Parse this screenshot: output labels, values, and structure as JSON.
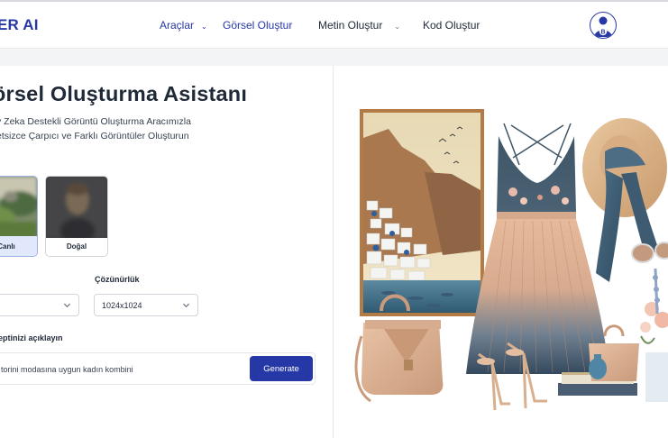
{
  "header": {
    "brand": "ER AI",
    "nav": [
      {
        "label": "Araçlar",
        "has_dropdown": true,
        "active": true
      },
      {
        "label": "Görsel Oluştur",
        "has_dropdown": false,
        "active": true
      },
      {
        "label": "Metin Oluştur",
        "has_dropdown": true,
        "active": false
      },
      {
        "label": "Kod Oluştur",
        "has_dropdown": false,
        "active": false
      }
    ],
    "avatar_initial": "B",
    "chevron": "⌄"
  },
  "main": {
    "title": "örsel Oluşturma Asistanı",
    "subtitle_line1": "y Zeka Destekli Görüntü Oluşturma Aracımızla",
    "subtitle_line2": "etsizce Çarpıcı ve Farklı Görüntüler Oluşturun",
    "styles": [
      {
        "label": "Canlı",
        "selected": true
      },
      {
        "label": "Doğal",
        "selected": false
      }
    ],
    "resolution_label": "Çözünürlük",
    "resolution_value": "1024x1024",
    "prompt_label": "eptinizi açıklayın",
    "prompt_value": "torini modasına uygun kadın kombini",
    "generate_label": "Generate"
  },
  "colors": {
    "accent": "#2638a6",
    "selected_card": "#e1e8fb"
  }
}
